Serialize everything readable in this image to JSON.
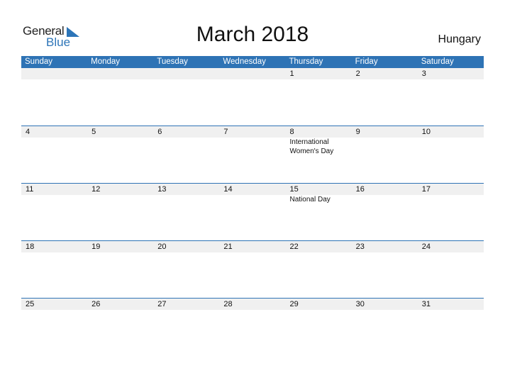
{
  "logo": {
    "line1": "General",
    "line2": "Blue"
  },
  "title": "March 2018",
  "country": "Hungary",
  "colors": {
    "header": "#2e73b5",
    "strip": "#f0f0f0",
    "brand": "#2d75b8"
  },
  "weekdays": [
    "Sunday",
    "Monday",
    "Tuesday",
    "Wednesday",
    "Thursday",
    "Friday",
    "Saturday"
  ],
  "weeks": [
    {
      "days": [
        "",
        "",
        "",
        "",
        "1",
        "2",
        "3"
      ],
      "events": [
        "",
        "",
        "",
        "",
        "",
        "",
        ""
      ]
    },
    {
      "days": [
        "4",
        "5",
        "6",
        "7",
        "8",
        "9",
        "10"
      ],
      "events": [
        "",
        "",
        "",
        "",
        "International Women's Day",
        "",
        ""
      ]
    },
    {
      "days": [
        "11",
        "12",
        "13",
        "14",
        "15",
        "16",
        "17"
      ],
      "events": [
        "",
        "",
        "",
        "",
        "National Day",
        "",
        ""
      ]
    },
    {
      "days": [
        "18",
        "19",
        "20",
        "21",
        "22",
        "23",
        "24"
      ],
      "events": [
        "",
        "",
        "",
        "",
        "",
        "",
        ""
      ]
    },
    {
      "days": [
        "25",
        "26",
        "27",
        "28",
        "29",
        "30",
        "31"
      ],
      "events": [
        "",
        "",
        "",
        "",
        "",
        "",
        ""
      ]
    }
  ]
}
